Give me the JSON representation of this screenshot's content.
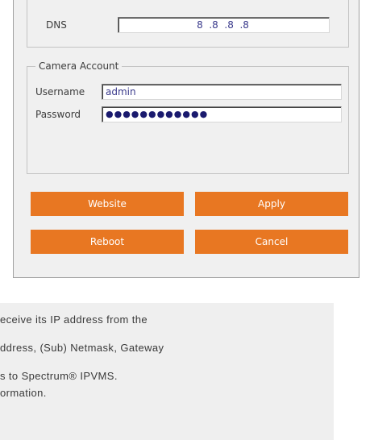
{
  "network": {
    "dns_label": "DNS",
    "dns_value": "8  .8  .8  .8"
  },
  "camera_account": {
    "legend": "Camera Account",
    "username_label": "Username",
    "username_value": "admin",
    "password_label": "Password",
    "password_value": "●●●●●●●●●●●●"
  },
  "buttons": {
    "website": "Website",
    "apply": "Apply",
    "reboot": "Reboot",
    "cancel": "Cancel"
  },
  "colors": {
    "accent": "#e87722",
    "panel_bg": "#f0f0f0",
    "notes_bg": "#efefef"
  },
  "notes": {
    "line1": "eceive its IP address from the",
    "line2": "ddress, (Sub) Netmask, Gateway",
    "line3": "s to Spectrum® IPVMS.",
    "line4": "ormation."
  }
}
